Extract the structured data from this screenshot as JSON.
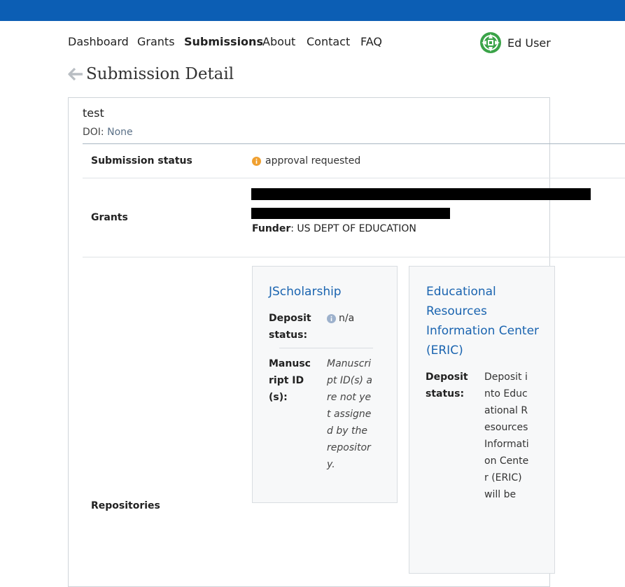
{
  "colors": {
    "topbar": "#0c5eb4",
    "link": "#1a64b0",
    "status_warning": "#f0a030",
    "info_icon": "#9db1cc"
  },
  "nav": {
    "items": [
      {
        "label": "Dashboard",
        "active": false
      },
      {
        "label": "Grants",
        "active": false
      },
      {
        "label": "Submissions",
        "active": true
      },
      {
        "label": "About",
        "active": false
      },
      {
        "label": "Contact",
        "active": false
      },
      {
        "label": "FAQ",
        "active": false
      }
    ],
    "user": {
      "name": "Ed User",
      "avatar_icon": "university-seal-icon"
    }
  },
  "header": {
    "back_icon": "arrow-left-icon",
    "title": "Submission Detail"
  },
  "submission": {
    "title": "test",
    "doi_label": "DOI:",
    "doi_value": "None",
    "status_label": "Submission status",
    "status_icon": "warning-circle-icon",
    "status_value": "approval requested",
    "grants_label": "Grants",
    "funder_label": "Funder",
    "funder_value": "US DEPT OF EDUCATION",
    "repositories_label": "Repositories"
  },
  "repositories": [
    {
      "name": "JScholarship",
      "deposit_status_label": "Deposit status:",
      "deposit_status_icon": "info-circle-icon",
      "deposit_status_value": "n/a",
      "manuscript_label": "Manuscript ID(s):",
      "manuscript_value": "Manuscript ID(s) are not yet assigned by the repository."
    },
    {
      "name": "Educational Resources Information Center (ERIC)",
      "deposit_status_label": "Deposit status:",
      "deposit_status_value": "Deposit into Educational Resources Information Center (ERIC) will be"
    }
  ]
}
